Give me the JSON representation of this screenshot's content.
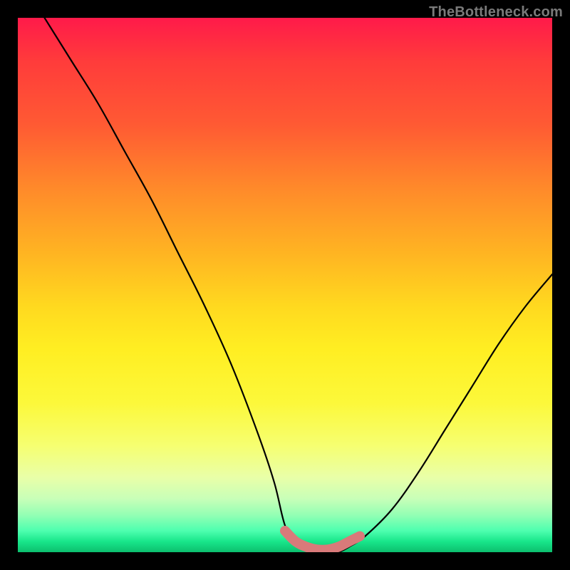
{
  "watermark": "TheBottleneck.com",
  "chart_data": {
    "type": "line",
    "title": "",
    "xlabel": "",
    "ylabel": "",
    "xlim": [
      0,
      100
    ],
    "ylim": [
      0,
      100
    ],
    "series": [
      {
        "name": "bottleneck-curve",
        "x": [
          5,
          10,
          15,
          20,
          25,
          30,
          35,
          40,
          45,
          48,
          50,
          52,
          55,
          58,
          60,
          62,
          65,
          70,
          75,
          80,
          85,
          90,
          95,
          100
        ],
        "values": [
          100,
          92,
          84,
          75,
          66,
          56,
          46,
          35,
          22,
          13,
          5,
          2,
          0,
          0,
          0,
          1,
          3,
          8,
          15,
          23,
          31,
          39,
          46,
          52
        ]
      },
      {
        "name": "bottleneck-zone",
        "x": [
          50,
          52,
          54,
          56,
          58,
          60,
          62,
          64
        ],
        "values": [
          4,
          2,
          1,
          0.5,
          0.5,
          1,
          2,
          3
        ]
      }
    ],
    "gradient_stops": [
      {
        "pos": 0,
        "color": "#ff1a4a"
      },
      {
        "pos": 20,
        "color": "#ff5a33"
      },
      {
        "pos": 45,
        "color": "#ffb422"
      },
      {
        "pos": 65,
        "color": "#ffee22"
      },
      {
        "pos": 85,
        "color": "#e9ffa8"
      },
      {
        "pos": 95,
        "color": "#4dffaf"
      },
      {
        "pos": 100,
        "color": "#0cbf6e"
      }
    ]
  }
}
